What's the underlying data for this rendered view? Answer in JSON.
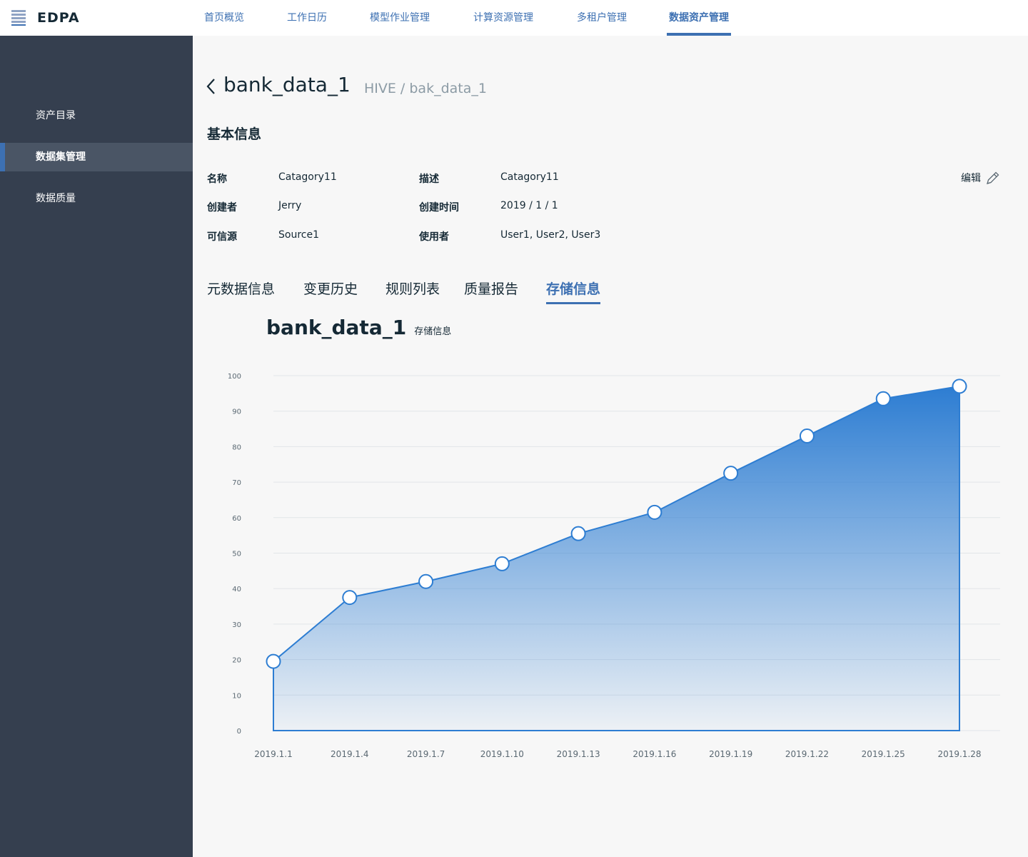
{
  "app": {
    "name": "EDPA"
  },
  "topnav": [
    {
      "label": "首页概览"
    },
    {
      "label": "工作日历"
    },
    {
      "label": "模型作业管理"
    },
    {
      "label": "计算资源管理"
    },
    {
      "label": "多租户管理"
    },
    {
      "label": "数据资产管理",
      "active": true
    }
  ],
  "sidebar": [
    {
      "label": "资产目录"
    },
    {
      "label": "数据集管理",
      "active": true
    },
    {
      "label": "数据质量"
    }
  ],
  "page": {
    "title": "bank_data_1",
    "breadcrumb": "HIVE / bak_data_1",
    "section_title": "基本信息",
    "edit_label": "编辑"
  },
  "info": {
    "name_label": "名称",
    "name_value": "Catagory11",
    "desc_label": "描述",
    "desc_value": "Catagory11",
    "creator_label": "创建者",
    "creator_value": "Jerry",
    "created_label": "创建时间",
    "created_value": "2019 / 1 / 1",
    "source_label": "可信源",
    "source_value": "Source1",
    "users_label": "使用者",
    "users_value": "User1, User2, User3"
  },
  "tabs": [
    {
      "label": "元数据信息"
    },
    {
      "label": "变更历史"
    },
    {
      "label": "规则列表"
    },
    {
      "label": "质量报告"
    },
    {
      "label": "存储信息",
      "active": true
    }
  ],
  "chart_heading": {
    "title": "bank_data_1",
    "subtitle": "存储信息"
  },
  "colors": {
    "accent": "#3d70b2",
    "sidebar": "#353f4f",
    "area_top": "#2d7dd2"
  },
  "chart_data": {
    "type": "area",
    "x": [
      "2019.1.1",
      "2019.1.4",
      "2019.1.7",
      "2019.1.10",
      "2019.1.13",
      "2019.1.16",
      "2019.1.19",
      "2019.1.22",
      "2019.1.25",
      "2019.1.28"
    ],
    "values": [
      19.5,
      37.5,
      42,
      47,
      55.5,
      61.5,
      72.5,
      83,
      93.5,
      97
    ],
    "xlabel": "",
    "ylabel": "",
    "ylim": [
      0,
      100
    ],
    "yticks": [
      0,
      10,
      20,
      30,
      40,
      50,
      60,
      70,
      80,
      90,
      100
    ],
    "grid": true
  }
}
